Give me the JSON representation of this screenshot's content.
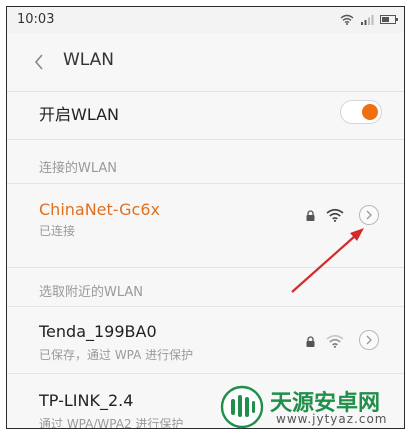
{
  "status_bar": {
    "time": "10:03",
    "icons": [
      "wifi-icon",
      "signal-icon",
      "battery-icon"
    ],
    "battery_fraction": 0.55
  },
  "header": {
    "title": "WLAN",
    "back_icon": "chevron-left-icon"
  },
  "wlan_toggle": {
    "label": "开启WLAN",
    "on": true,
    "accent": "#f07010"
  },
  "connected_section": {
    "heading": "连接的WLAN",
    "network": {
      "name": "ChinaNet-Gc6x",
      "status": "已连接",
      "name_color": "#e07020",
      "secured": true
    }
  },
  "nearby_section": {
    "heading": "选取附近的WLAN",
    "networks": [
      {
        "name": "Tenda_199BA0",
        "status": "已保存，通过 WPA 进行保护",
        "secured": true
      },
      {
        "name": "TP-LINK_2.4",
        "status": "通过 WPA/WPA2 进行保护",
        "secured": true
      }
    ]
  },
  "annotation": {
    "arrow_color": "#d42a2a"
  },
  "watermark": {
    "title": "天源安卓网",
    "url": "www.jytyaz.com",
    "color": "#1f8f4a"
  }
}
